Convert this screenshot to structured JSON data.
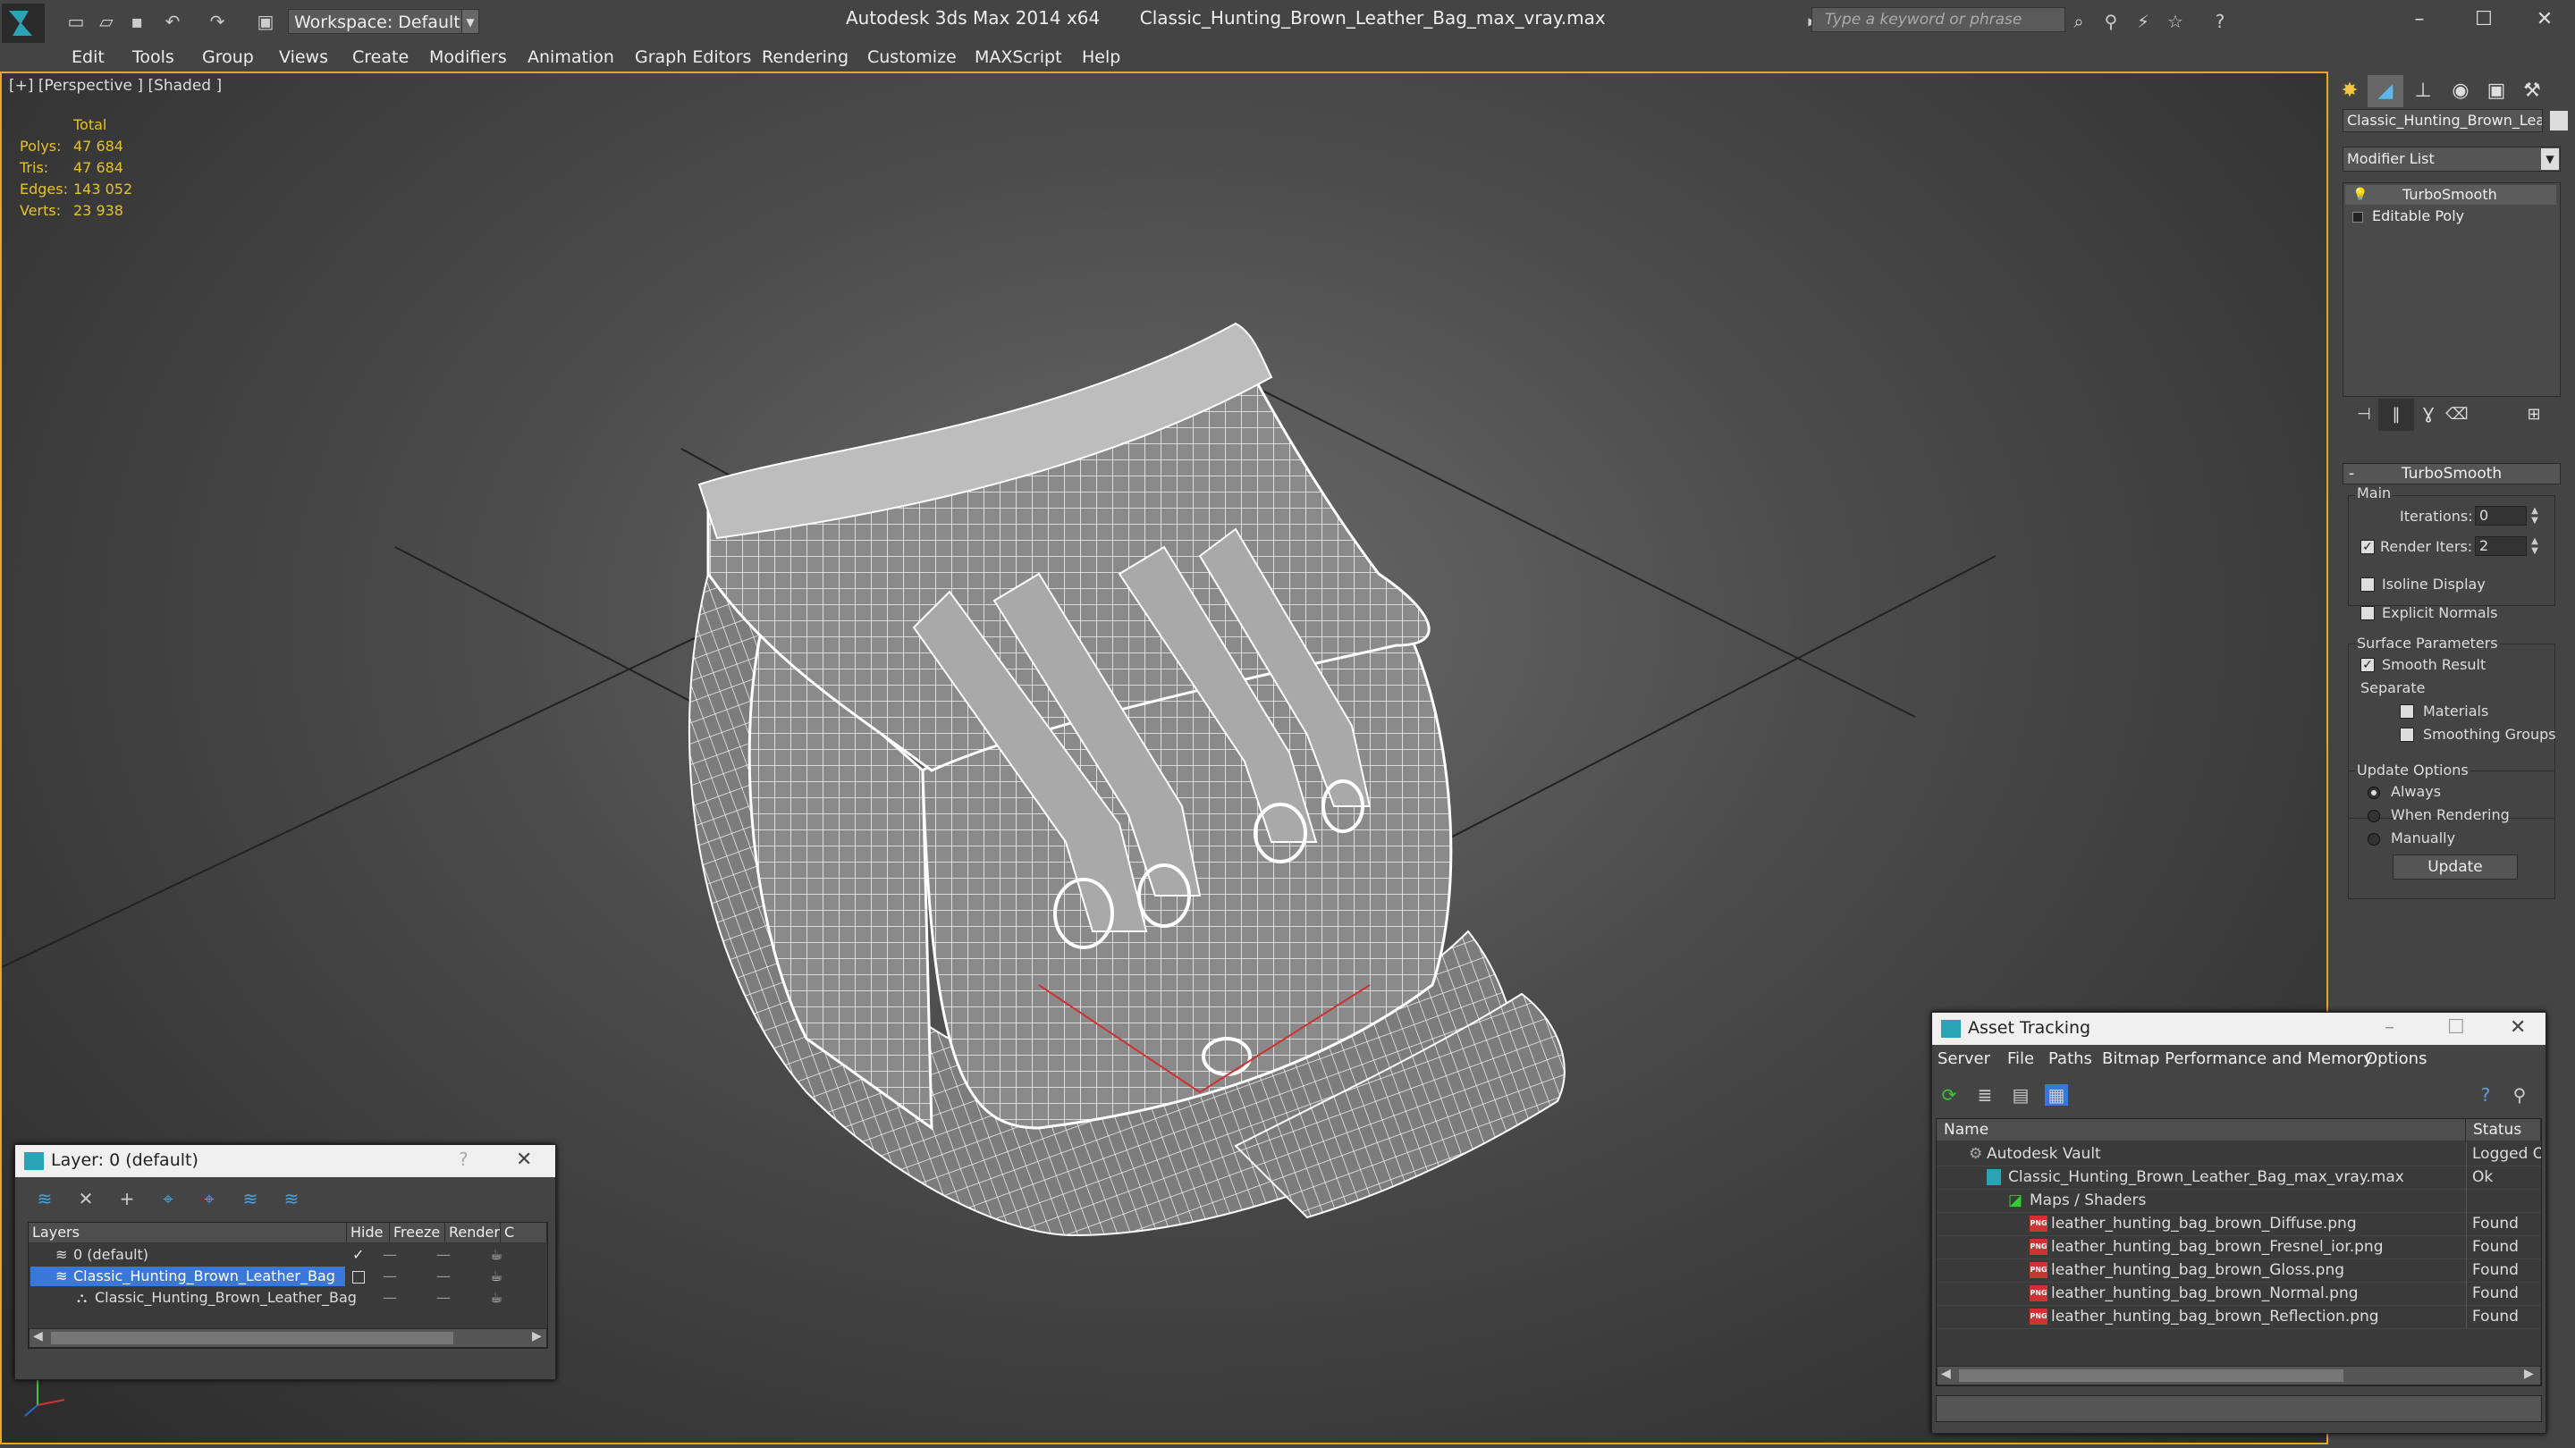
{
  "window": {
    "workspace": "Workspace: Default",
    "app_title": "Autodesk 3ds Max 2014 x64       Classic_Hunting_Brown_Leather_Bag_max_vray.max",
    "search_placeholder": "Type a keyword or phrase"
  },
  "menu": [
    "Edit",
    "Tools",
    "Group",
    "Views",
    "Create",
    "Modifiers",
    "Animation",
    "Graph Editors",
    "Rendering",
    "Customize",
    "MAXScript",
    "Help"
  ],
  "viewport": {
    "label": "[+] [Perspective ] [Shaded ]",
    "stats": {
      "header": "Total",
      "rows": [
        {
          "label": "Polys:",
          "value": "47 684"
        },
        {
          "label": "Tris:",
          "value": "47 684"
        },
        {
          "label": "Edges:",
          "value": "143 052"
        },
        {
          "label": "Verts:",
          "value": "23 938"
        }
      ]
    }
  },
  "command_panel": {
    "object_name": "Classic_Hunting_Brown_Leath",
    "modifier_list": "Modifier List",
    "stack": [
      "TurboSmooth",
      "Editable Poly"
    ],
    "rollout_title": "TurboSmooth",
    "main_group": "Main",
    "iterations_label": "Iterations:",
    "iterations_value": "0",
    "render_iters_label": "Render Iters:",
    "render_iters_value": "2",
    "isoline_label": "Isoline Display",
    "explicit_normals_label": "Explicit Normals",
    "surface_group": "Surface Parameters",
    "smooth_result_label": "Smooth Result",
    "separate_label": "Separate",
    "materials_label": "Materials",
    "smoothing_groups_label": "Smoothing Groups",
    "update_group": "Update Options",
    "update_options": [
      "Always",
      "When Rendering",
      "Manually"
    ],
    "update_selected": 0,
    "update_button": "Update"
  },
  "layer_dialog": {
    "title": "Layer: 0 (default)",
    "help": "?",
    "columns": [
      "Layers",
      "Hide",
      "Freeze",
      "Render",
      "C"
    ],
    "rows": [
      {
        "name": "0 (default)"
      },
      {
        "name": "Classic_Hunting_Brown_Leather_Bag"
      },
      {
        "name": "Classic_Hunting_Brown_Leather_Bag"
      }
    ]
  },
  "asset_tracking": {
    "title": "Asset Tracking",
    "menu": [
      "Server",
      "File",
      "Paths",
      "Bitmap Performance and Memory",
      "Options"
    ],
    "columns": [
      "Name",
      "Status"
    ],
    "rows": [
      {
        "name": "Autodesk Vault",
        "status": "Logged O"
      },
      {
        "name": "Classic_Hunting_Brown_Leather_Bag_max_vray.max",
        "status": "Ok"
      },
      {
        "name": "Maps / Shaders",
        "status": ""
      },
      {
        "name": "leather_hunting_bag_brown_Diffuse.png",
        "status": "Found"
      },
      {
        "name": "leather_hunting_bag_brown_Fresnel_ior.png",
        "status": "Found"
      },
      {
        "name": "leather_hunting_bag_brown_Gloss.png",
        "status": "Found"
      },
      {
        "name": "leather_hunting_bag_brown_Normal.png",
        "status": "Found"
      },
      {
        "name": "leather_hunting_bag_brown_Reflection.png",
        "status": "Found"
      }
    ],
    "png_badge": "PNG"
  },
  "colors": {
    "accent": "#e8a52a",
    "selection": "#3a78d8",
    "stats": "#e6c02e"
  }
}
